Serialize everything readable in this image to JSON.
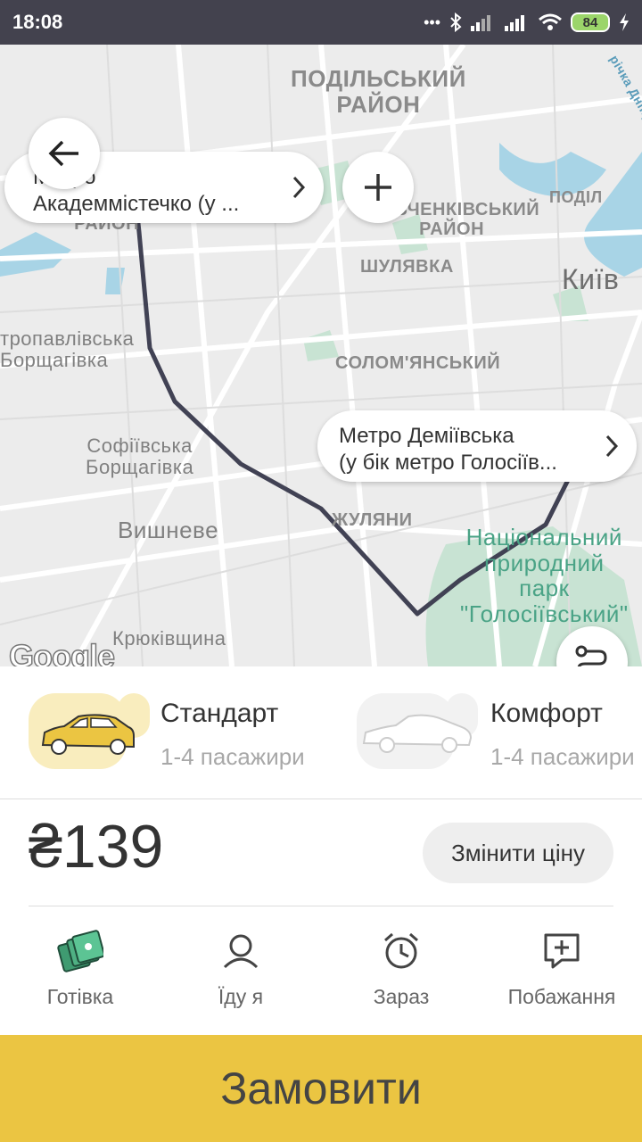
{
  "status_bar": {
    "time": "18:08",
    "battery": "84"
  },
  "map": {
    "labels": {
      "podilskyi": "ПОДІЛЬСЬКИЙ\nРАЙОН",
      "sviatoshynskyi": "СВЯТОШИНСЬКИЙ\nРАЙОН",
      "shevchenkivskyi": "ШЕВЧЕНКІВСЬКИЙ\nРАЙОН",
      "shuliavka": "ШУЛЯВКА",
      "solomianskyi": "СОЛОМ'ЯНСЬКИЙ",
      "kyiv": "Київ",
      "petropavlivska": "тропавлівська\nБорщагівка",
      "sofiivska": "Софіївська\nБорщагівка",
      "vyshneve": "Вишневе",
      "zhuliany": "ЖУЛЯНИ",
      "park": "Національний\nприродний\nпарк\n\"Голосіївський\"",
      "kriukivshchyna": "Крюківщина",
      "podil": "ПОДІЛ",
      "river": "річка Дніпро"
    },
    "google_logo": "Google",
    "pickup": {
      "line1": "Метро",
      "line2": "Академмістечко (у ..."
    },
    "destination": {
      "line1": "Метро Деміївська",
      "line2": "(у бік метро Голосіїв..."
    }
  },
  "tariffs": [
    {
      "name": "Стандарт",
      "subtitle": "1-4 пасажири",
      "selected": true
    },
    {
      "name": "Комфорт",
      "subtitle": "1-4 пасажири",
      "selected": false
    }
  ],
  "price": {
    "value": "₴139",
    "change_label": "Змінити ціну"
  },
  "options": [
    {
      "label": "Готівка",
      "icon": "cash-icon"
    },
    {
      "label": "Їду я",
      "icon": "person-icon"
    },
    {
      "label": "Зараз",
      "icon": "alarm-clock-icon"
    },
    {
      "label": "Побажання",
      "icon": "comment-add-icon"
    }
  ],
  "order_label": "Замовити",
  "colors": {
    "accent": "#ebc542",
    "status_bar": "#43424e",
    "route": "#414254",
    "cash_green": "#3f9b71"
  }
}
